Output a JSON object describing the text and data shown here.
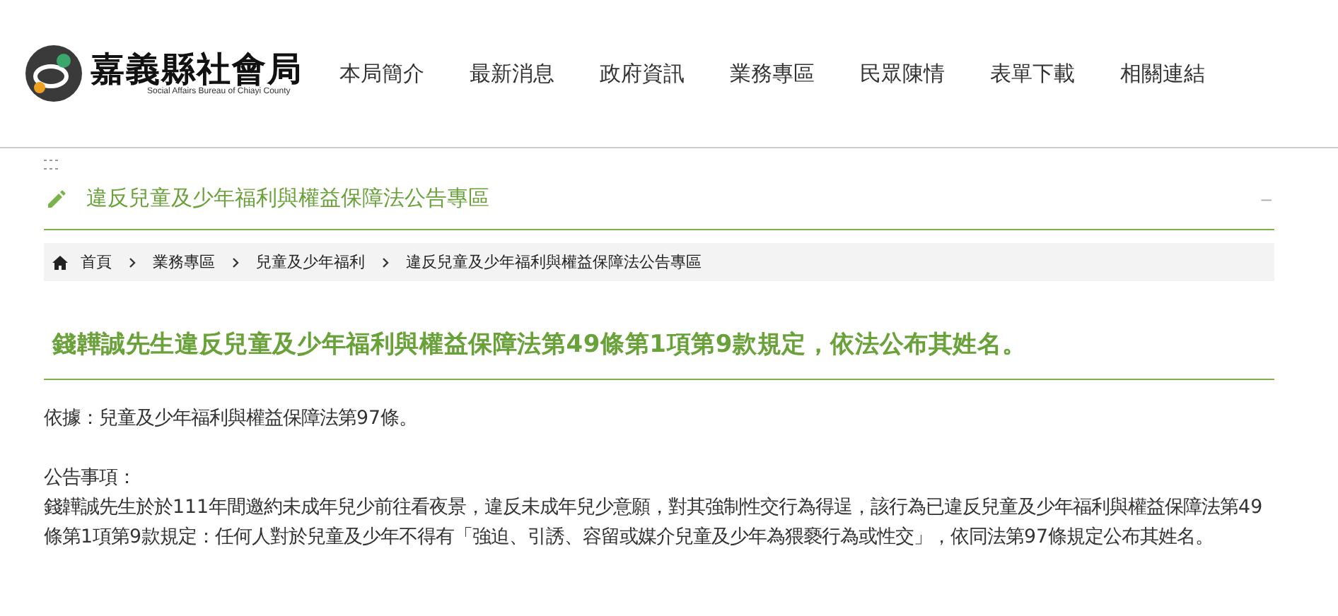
{
  "logo": {
    "title": "嘉義縣社會局",
    "subtitle": "Social Affairs Bureau of Chiayi County"
  },
  "nav": [
    {
      "label": "本局簡介"
    },
    {
      "label": "最新消息"
    },
    {
      "label": "政府資訊"
    },
    {
      "label": "業務專區"
    },
    {
      "label": "民眾陳情"
    },
    {
      "label": "表單下載"
    },
    {
      "label": "相關連結"
    }
  ],
  "section": {
    "title": "違反兒童及少年福利與權益保障法公告專區",
    "collapse": "–"
  },
  "breadcrumb": [
    "首頁",
    "業務專區",
    "兒童及少年福利",
    "違反兒童及少年福利與權益保障法公告專區"
  ],
  "article": {
    "heading": "錢韡誠先生違反兒童及少年福利與權益保障法第49條第1項第9款規定，依法公布其姓名。",
    "basis": "依據：兒童及少年福利與權益保障法第97條。",
    "notice_label": "公告事項：",
    "notice": "錢韡誠先生於於111年間邀約未成年兒少前往看夜景，違反未成年兒少意願，對其強制性交行為得逞，該行為已違反兒童及少年福利與權益保障法第49條第1項第9款規定：任何人對於兒童及少年不得有「強迫、引誘、容留或媒介兒童及少年為猥褻行為或性交」，依同法第97條規定公布其姓名。"
  }
}
